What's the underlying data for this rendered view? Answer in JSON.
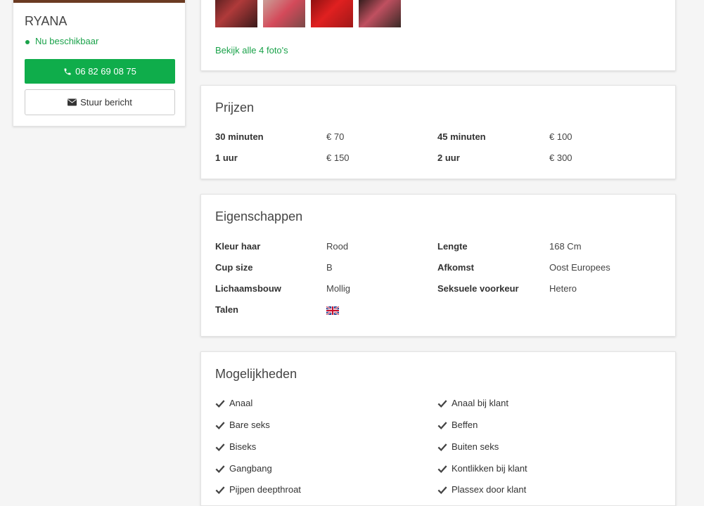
{
  "profile": {
    "name": "RYANA",
    "availability": "Nu beschikbaar",
    "phone_button": "06 82 69 08 75",
    "message_button": "Stuur bericht",
    "phone_icon": "phone-icon",
    "message_icon": "envelope-icon",
    "accent": "#0fad4b"
  },
  "photos": {
    "link": "Bekijk alle 4 foto's"
  },
  "prices": {
    "title": "Prijzen",
    "rows": [
      {
        "label": "30 minuten",
        "value": "€ 70"
      },
      {
        "label": "45 minuten",
        "value": "€ 100"
      },
      {
        "label": "1 uur",
        "value": "€ 150"
      },
      {
        "label": "2 uur",
        "value": "€ 300"
      }
    ]
  },
  "properties": {
    "title": "Eigenschappen",
    "rows": [
      {
        "label": "Kleur haar",
        "value": "Rood"
      },
      {
        "label": "Lengte",
        "value": "168 Cm"
      },
      {
        "label": "Cup size",
        "value": "B"
      },
      {
        "label": "Afkomst",
        "value": "Oost Europees"
      },
      {
        "label": "Lichaamsbouw",
        "value": "Mollig"
      },
      {
        "label": "Seksuele voorkeur",
        "value": "Hetero"
      },
      {
        "label": "Talen",
        "value_icon": "uk-flag-icon"
      }
    ]
  },
  "options": {
    "title": "Mogelijkheden",
    "items": [
      "Anaal",
      "Anaal bij klant",
      "Bare seks",
      "Beffen",
      "Biseks",
      "Buiten seks",
      "Gangbang",
      "Kontlikken bij klant",
      "Pijpen deepthroat",
      "Plassex door klant"
    ]
  }
}
